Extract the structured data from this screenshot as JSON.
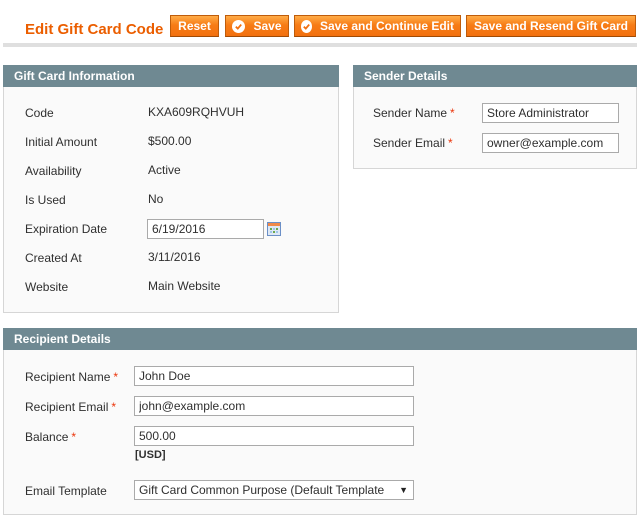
{
  "header": {
    "title": "Edit Gift Card Code",
    "buttons": {
      "reset": "Reset",
      "save": "Save",
      "save_continue": "Save and Continue Edit",
      "save_resend": "Save and Resend Gift Card"
    }
  },
  "gift_card_info": {
    "title": "Gift Card Information",
    "rows": [
      {
        "label": "Code",
        "value": "KXA609RQHVUH"
      },
      {
        "label": "Initial Amount",
        "value": "$500.00"
      },
      {
        "label": "Availability",
        "value": "Active"
      },
      {
        "label": "Is Used",
        "value": "No"
      },
      {
        "label": "Expiration Date",
        "value": "6/19/2016"
      },
      {
        "label": "Created At",
        "value": "3/11/2016"
      },
      {
        "label": "Website",
        "value": "Main Website"
      }
    ],
    "calendar_icon": "calendar-icon"
  },
  "sender": {
    "title": "Sender Details",
    "name_label": "Sender Name",
    "name_value": "Store Administrator",
    "email_label": "Sender Email",
    "email_value": "owner@example.com",
    "required_mark": "*"
  },
  "recipient": {
    "title": "Recipient Details",
    "name_label": "Recipient Name",
    "name_value": "John Doe",
    "email_label": "Recipient Email",
    "email_value": "john@example.com",
    "balance_label": "Balance",
    "balance_value": "500.00",
    "currency": "[USD]",
    "template_label": "Email Template",
    "template_value": "Gift Card Common Purpose (Default Template",
    "required_mark": "*"
  },
  "colors": {
    "accent": "#eb5e00",
    "button": "#f77c16",
    "section_header": "#6f8992",
    "required": "#eb340a"
  }
}
